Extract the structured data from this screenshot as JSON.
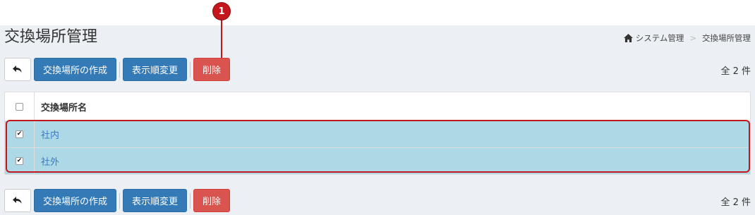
{
  "page": {
    "title": "交換場所管理"
  },
  "breadcrumb": {
    "items": [
      "システム管理",
      "交換場所管理"
    ],
    "separator": ">"
  },
  "toolbar": {
    "back_icon": "undo-arrow-icon",
    "create_label": "交換場所の作成",
    "reorder_label": "表示順変更",
    "delete_label": "削除",
    "count_label": "全 2 件"
  },
  "table": {
    "header": {
      "name": "交換場所名"
    },
    "rows": [
      {
        "name": "社内",
        "checked": true
      },
      {
        "name": "社外",
        "checked": true
      }
    ]
  },
  "annotation": {
    "callout_number": "1"
  },
  "colors": {
    "primary": "#337ab7",
    "danger": "#d9534f",
    "selected_row": "#add8e6",
    "annotation": "#c4161c",
    "content_bg": "#ecf0f5"
  }
}
